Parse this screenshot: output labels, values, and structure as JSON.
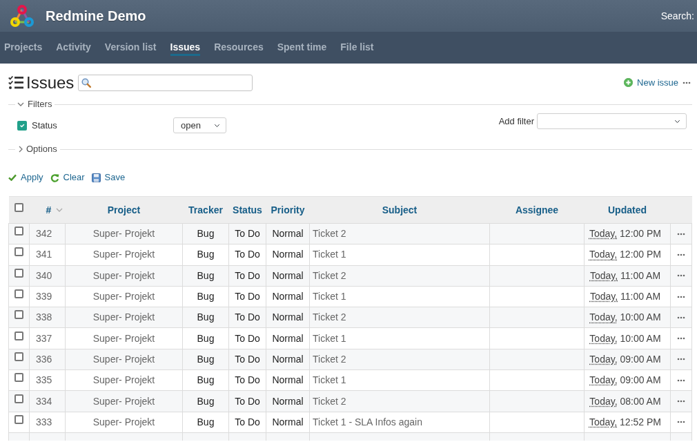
{
  "header": {
    "title": "Redmine Demo",
    "search_label": "Search:"
  },
  "menu": [
    {
      "label": "Projects",
      "selected": false
    },
    {
      "label": "Activity",
      "selected": false
    },
    {
      "label": "Version list",
      "selected": false
    },
    {
      "label": "Issues",
      "selected": true
    },
    {
      "label": "Resources",
      "selected": false
    },
    {
      "label": "Spent time",
      "selected": false
    },
    {
      "label": "File list",
      "selected": false
    }
  ],
  "page": {
    "title": "Issues",
    "new_issue": "New issue"
  },
  "filters": {
    "legend": "Filters",
    "expanded": true,
    "items": [
      {
        "label": "Status",
        "checked": true,
        "operator": "open"
      }
    ],
    "add_filter_label": "Add filter"
  },
  "options": {
    "legend": "Options",
    "expanded": false
  },
  "actions": [
    {
      "kind": "apply",
      "label": "Apply"
    },
    {
      "kind": "clear",
      "label": "Clear"
    },
    {
      "kind": "save",
      "label": "Save"
    }
  ],
  "table": {
    "select_all_checked": false,
    "columns": [
      {
        "label": "#",
        "sorted": true
      },
      {
        "label": "Project",
        "sorted": false
      },
      {
        "label": "Tracker",
        "sorted": false
      },
      {
        "label": "Status",
        "sorted": false
      },
      {
        "label": "Priority",
        "sorted": false
      },
      {
        "label": "Subject",
        "sorted": false
      },
      {
        "label": "Assignee",
        "sorted": false
      },
      {
        "label": "Updated",
        "sorted": false
      }
    ],
    "rows": [
      {
        "checked": false,
        "id": "342",
        "project": "Super- Projekt",
        "tracker": "Bug",
        "status": "To Do",
        "priority": "Normal",
        "subject": "Ticket 2",
        "updated": {
          "date": "Today,",
          "time": "12:00 PM"
        }
      },
      {
        "checked": false,
        "id": "341",
        "project": "Super- Projekt",
        "tracker": "Bug",
        "status": "To Do",
        "priority": "Normal",
        "subject": "Ticket 1",
        "updated": {
          "date": "Today,",
          "time": "12:00 PM"
        }
      },
      {
        "checked": false,
        "id": "340",
        "project": "Super- Projekt",
        "tracker": "Bug",
        "status": "To Do",
        "priority": "Normal",
        "subject": "Ticket 2",
        "updated": {
          "date": "Today,",
          "time": "11:00 AM"
        }
      },
      {
        "checked": false,
        "id": "339",
        "project": "Super- Projekt",
        "tracker": "Bug",
        "status": "To Do",
        "priority": "Normal",
        "subject": "Ticket 1",
        "updated": {
          "date": "Today,",
          "time": "11:00 AM"
        }
      },
      {
        "checked": false,
        "id": "338",
        "project": "Super- Projekt",
        "tracker": "Bug",
        "status": "To Do",
        "priority": "Normal",
        "subject": "Ticket 2",
        "updated": {
          "date": "Today,",
          "time": "10:00 AM"
        }
      },
      {
        "checked": false,
        "id": "337",
        "project": "Super- Projekt",
        "tracker": "Bug",
        "status": "To Do",
        "priority": "Normal",
        "subject": "Ticket 1",
        "updated": {
          "date": "Today,",
          "time": "10:00 AM"
        }
      },
      {
        "checked": false,
        "id": "336",
        "project": "Super- Projekt",
        "tracker": "Bug",
        "status": "To Do",
        "priority": "Normal",
        "subject": "Ticket 2",
        "updated": {
          "date": "Today,",
          "time": "09:00 AM"
        }
      },
      {
        "checked": false,
        "id": "335",
        "project": "Super- Projekt",
        "tracker": "Bug",
        "status": "To Do",
        "priority": "Normal",
        "subject": "Ticket 1",
        "updated": {
          "date": "Today,",
          "time": "09:00 AM"
        }
      },
      {
        "checked": false,
        "id": "334",
        "project": "Super- Projekt",
        "tracker": "Bug",
        "status": "To Do",
        "priority": "Normal",
        "subject": "Ticket 2",
        "updated": {
          "date": "Today,",
          "time": "08:00 AM"
        }
      },
      {
        "checked": false,
        "id": "333",
        "project": "Super- Projekt",
        "tracker": "Bug",
        "status": "To Do",
        "priority": "Normal",
        "subject": "Ticket 1 - SLA Infos again",
        "updated": {
          "date": "Today,",
          "time": "12:52 PM"
        }
      }
    ]
  }
}
